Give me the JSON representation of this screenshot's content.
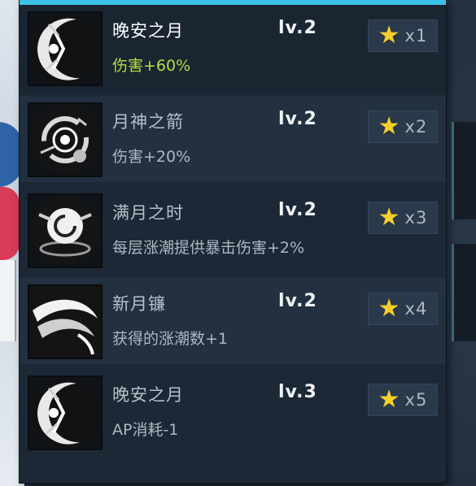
{
  "skills": [
    {
      "name": "晚安之月",
      "level": "lv.2",
      "effect": "伤害+60%",
      "count": "x1",
      "icon": "crescent-rune-icon"
    },
    {
      "name": "月神之箭",
      "level": "lv.2",
      "effect": "伤害+20%",
      "count": "x2",
      "icon": "moon-orb-icon"
    },
    {
      "name": "满月之时",
      "level": "lv.2",
      "effect": "每层涨潮提供暴击伤害+2%",
      "count": "x3",
      "icon": "full-moon-orb-icon"
    },
    {
      "name": "新月镰",
      "level": "lv.2",
      "effect": "获得的涨潮数+1",
      "count": "x4",
      "icon": "sickle-slash-icon"
    },
    {
      "name": "晚安之月",
      "level": "lv.3",
      "effect": "AP消耗-1",
      "count": "x5",
      "icon": "crescent-rune-icon"
    }
  ],
  "colors": {
    "accent": "#3ac3e6",
    "highlight_effect": "#b6dd3e",
    "star": "#f7cf2c"
  }
}
